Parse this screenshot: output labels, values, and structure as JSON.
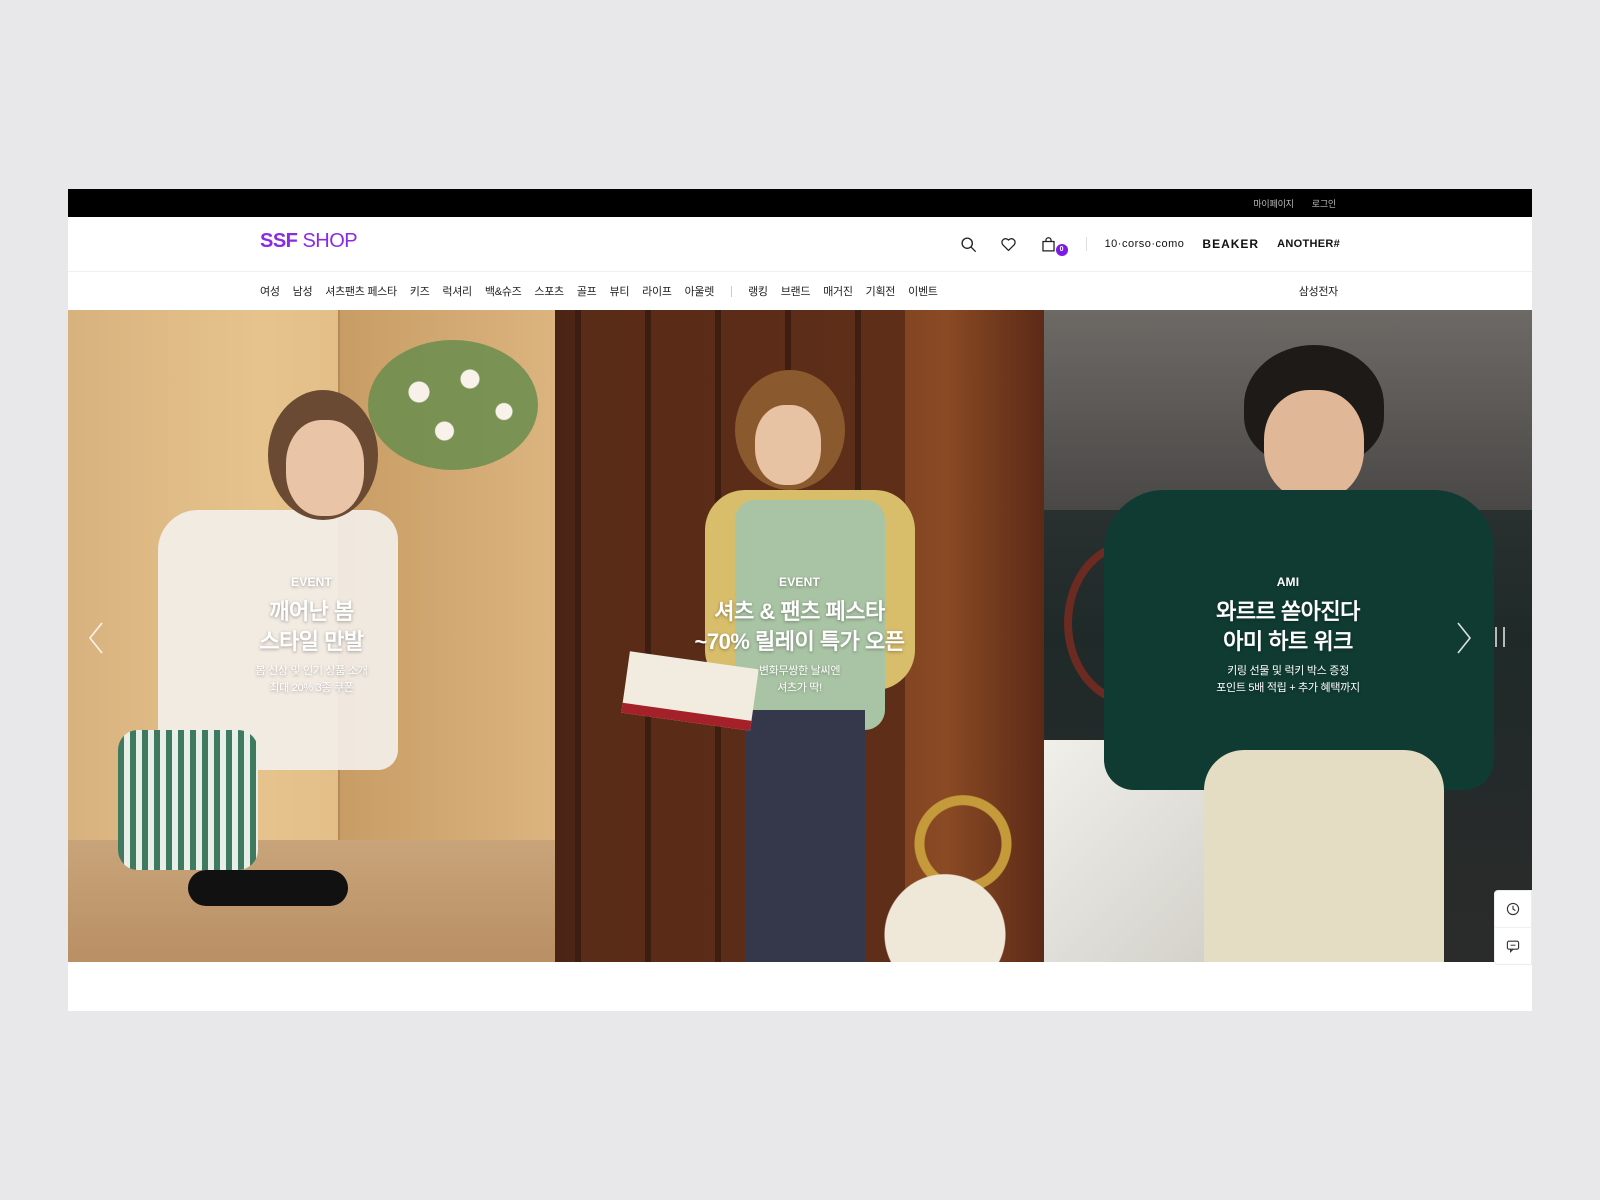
{
  "topbar": {
    "mypage": "마이페이지",
    "login": "로그인"
  },
  "logo": {
    "part1": "SSF",
    "part2": " SHOP"
  },
  "header": {
    "cart_count": "0",
    "brands": [
      "10·corso·como",
      "BEAKER",
      "ANOTHER#"
    ]
  },
  "gnb": {
    "items": [
      "여성",
      "남성",
      "셔츠팬츠 페스타",
      "키즈",
      "럭셔리",
      "백&슈즈",
      "스포츠",
      "골프",
      "뷰티",
      "라이프",
      "아울렛"
    ],
    "items2": [
      "랭킹",
      "브랜드",
      "매거진",
      "기획전",
      "이벤트"
    ],
    "right": "삼성전자"
  },
  "hero": {
    "slides": [
      {
        "tag": "EVENT",
        "title1": "깨어난 봄",
        "title2": "스타일 만발",
        "sub1": "봄 신상 및 인기 상품 소개",
        "sub2": "최대 20% 3종 쿠폰"
      },
      {
        "tag": "EVENT",
        "title1": "셔츠 & 팬츠 페스타",
        "title2": "~70% 릴레이 특가 오픈",
        "sub1": "변화무쌍한 날씨엔",
        "sub2": "셔츠가 딱!"
      },
      {
        "tag": "AMI",
        "title1": "와르르 쏟아진다",
        "title2": "아미 하트 위크",
        "sub1": "키링 선물 및 럭키 박스 증정",
        "sub2": "포인트 5배 적립 + 추가 혜택까지"
      }
    ]
  },
  "colors": {
    "brand": "#8b2be2",
    "badge": "#7a1be5",
    "topbar": "#000000"
  },
  "icons": [
    "search-icon",
    "heart-icon",
    "bag-icon",
    "chevron-left-icon",
    "chevron-right-icon",
    "pause-icon",
    "history-icon",
    "chat-icon"
  ]
}
